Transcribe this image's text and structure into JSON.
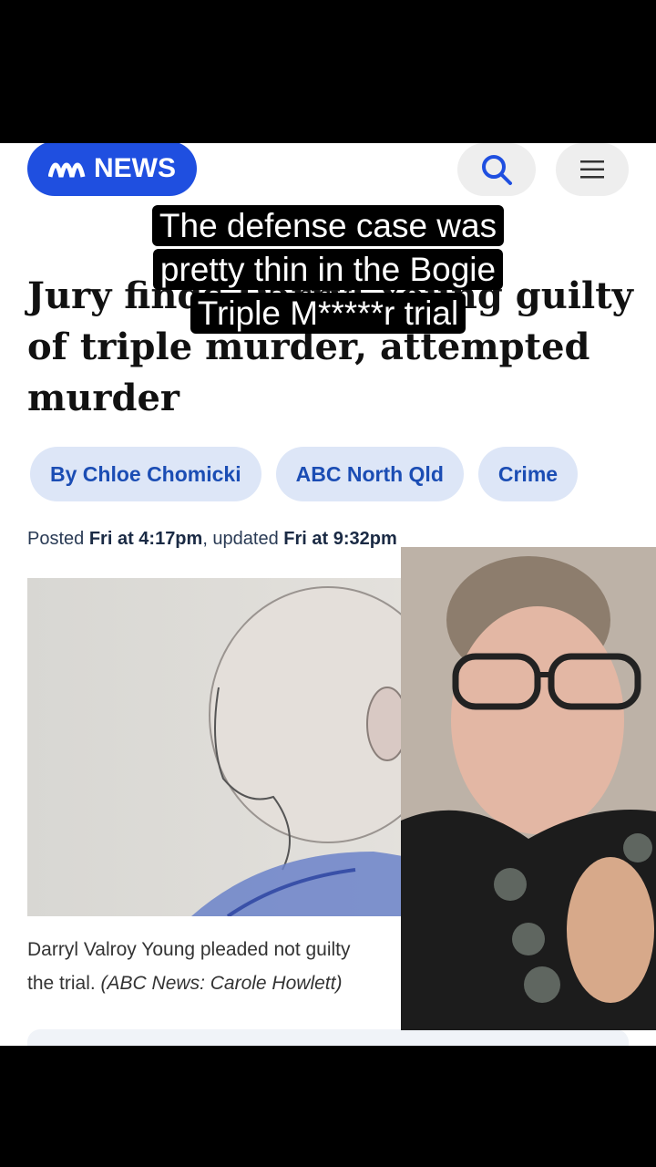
{
  "header": {
    "brand": "NEWS",
    "brand_mark": "ABC",
    "colors": {
      "brand_blue": "#1f4fe0",
      "chip_bg": "#dde6f7",
      "chip_text": "#1b4db4"
    }
  },
  "article": {
    "headline": "Jury finds Darryl Young guilty of triple murder, attempted murder",
    "chips": [
      "By Chloe Chomicki",
      "ABC North Qld",
      "Crime"
    ],
    "posted_label": "Posted",
    "posted_time": "Fri at 4:17pm",
    "updated_label": ", updated",
    "updated_time": "Fri at 9:32pm",
    "caption_text": "Darryl Valroy Young pleaded not guilty",
    "caption_text2": "the trial.",
    "caption_credit": "(ABC News: Carole Howlett)"
  },
  "overlay": {
    "subtitle_line1": "The defense case was",
    "subtitle_line2": "pretty thin in the Bogie",
    "subtitle_line3": "Triple M*****r trial"
  },
  "icons": {
    "search": "search-icon",
    "menu": "menu-icon"
  }
}
